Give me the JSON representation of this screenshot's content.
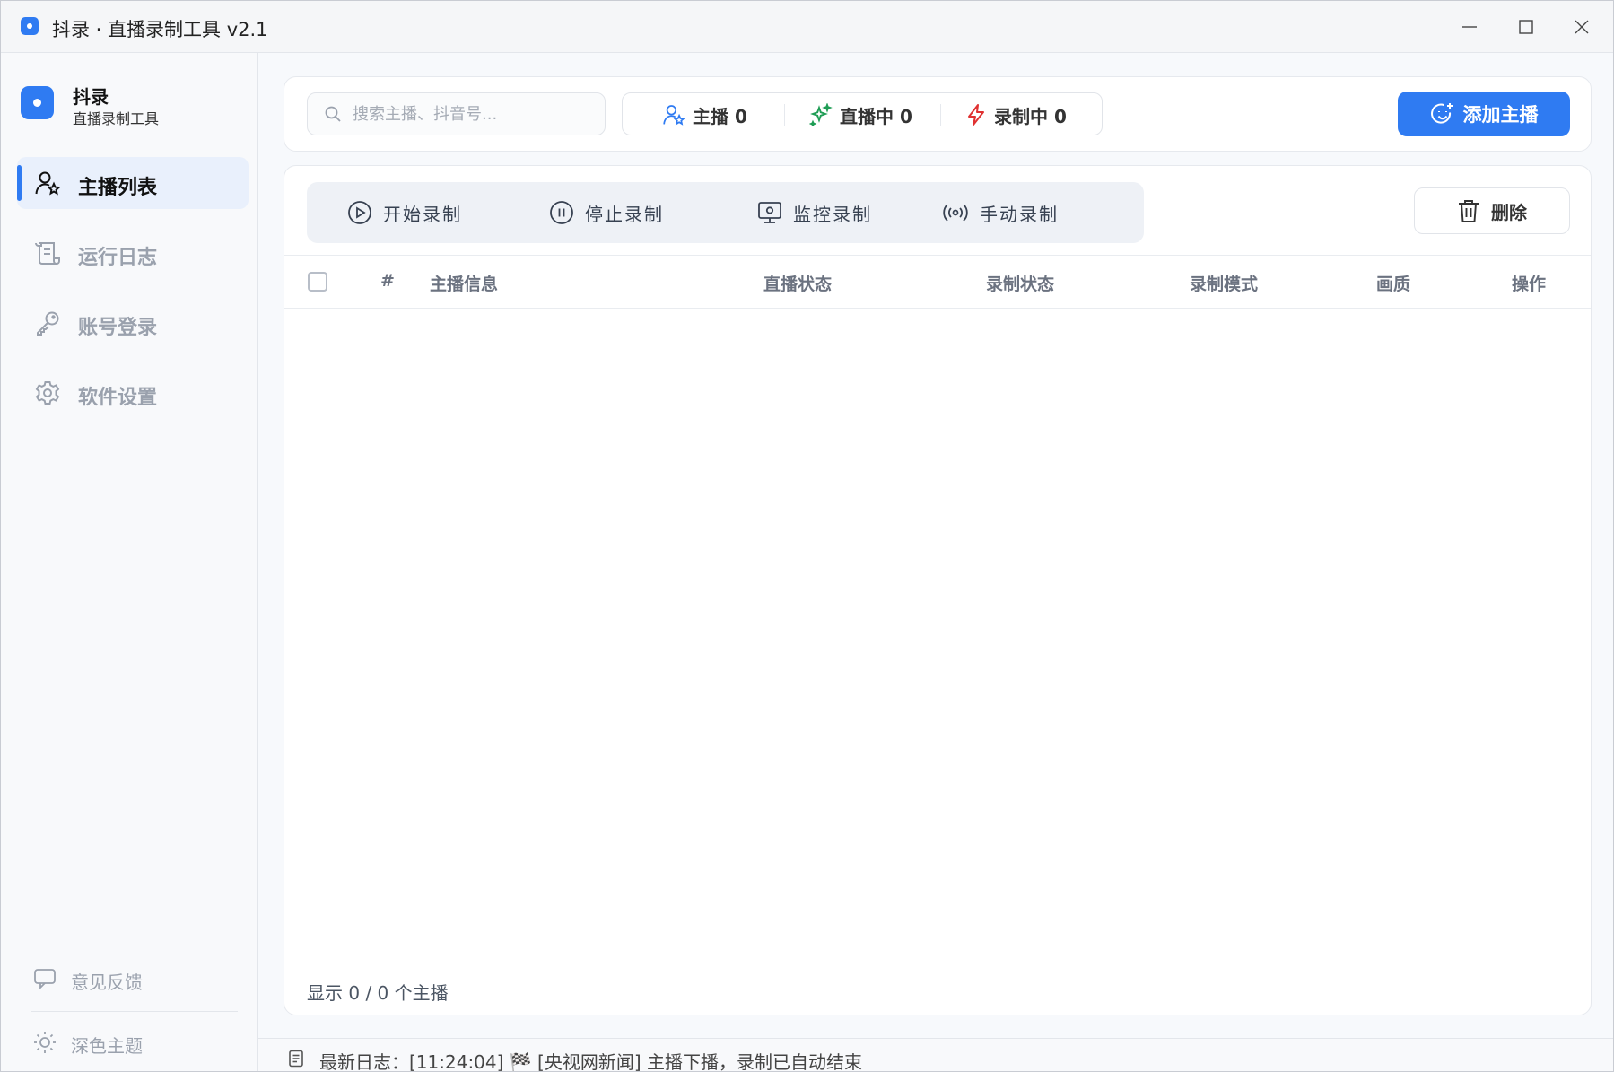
{
  "window": {
    "title": "抖录 · 直播录制工具 v2.1"
  },
  "sidebar": {
    "brand_name": "抖录",
    "brand_sub": "直播录制工具",
    "items": [
      {
        "label": "主播列表",
        "icon": "users-star-icon",
        "active": true
      },
      {
        "label": "运行日志",
        "icon": "scroll-log-icon",
        "active": false
      },
      {
        "label": "账号登录",
        "icon": "key-icon",
        "active": false
      },
      {
        "label": "软件设置",
        "icon": "gear-icon",
        "active": false
      }
    ],
    "bottom": {
      "feedback": "意见反馈",
      "theme": "深色主题"
    }
  },
  "toolbar_top": {
    "search_placeholder": "搜索主播、抖音号...",
    "stats": {
      "anchors": "主播 0",
      "live": "直播中 0",
      "recording": "录制中 0"
    },
    "add_button": "添加主播"
  },
  "actions": {
    "start": "开始录制",
    "stop": "停止录制",
    "monitor": "监控录制",
    "manual": "手动录制",
    "delete": "删除"
  },
  "table": {
    "columns": [
      "#",
      "主播信息",
      "直播状态",
      "录制状态",
      "录制模式",
      "画质",
      "操作"
    ],
    "rows": []
  },
  "footer": {
    "count_text": "显示 0 / 0 个主播"
  },
  "status_bar": {
    "log_text": "最新日志：[11:24:04] 🏁 [央视网新闻] 主播下播，录制已自动结束"
  },
  "colors": {
    "accent": "#2f7bf2",
    "live_green": "#1f9d55",
    "recording_red": "#e03131"
  }
}
